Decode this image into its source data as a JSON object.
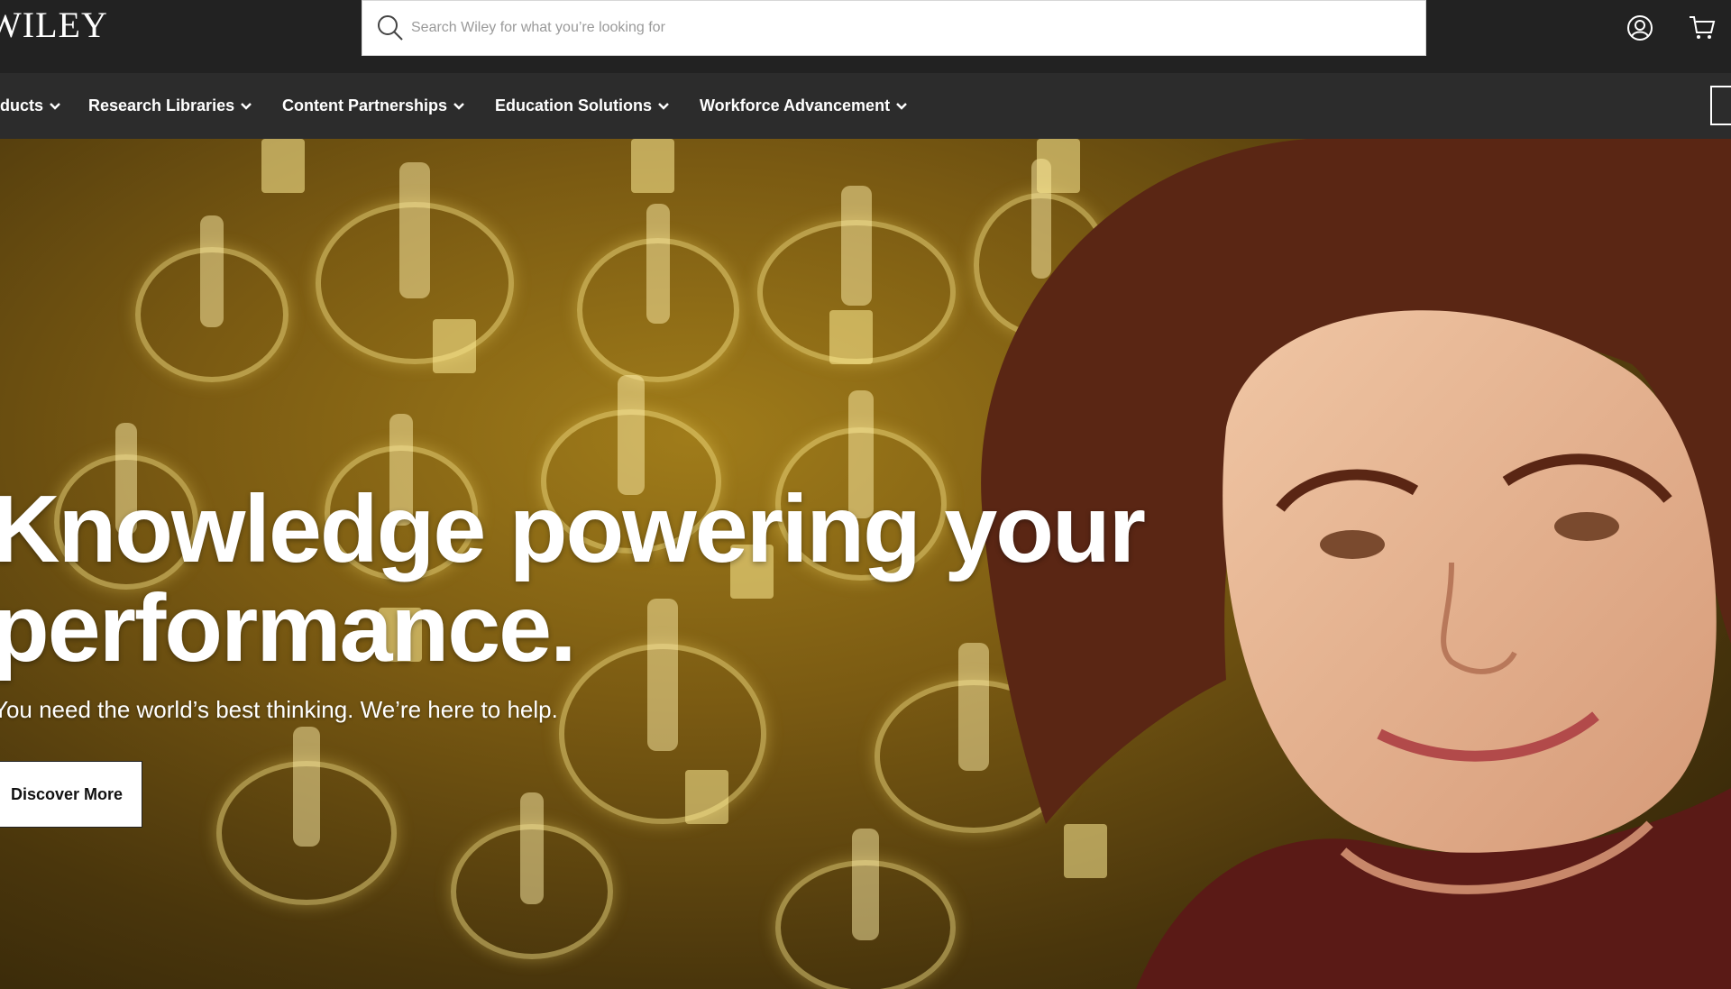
{
  "brand": {
    "logo_text": "WILEY"
  },
  "search": {
    "placeholder": "Search Wiley for what you’re looking for",
    "value": ""
  },
  "header_icons": [
    "search-icon",
    "account-icon",
    "cart-icon"
  ],
  "nav": {
    "items": [
      {
        "label": "Products"
      },
      {
        "label": "Research Libraries"
      },
      {
        "label": "Content Partnerships"
      },
      {
        "label": "Education Solutions"
      },
      {
        "label": "Workforce Advancement"
      }
    ]
  },
  "hero": {
    "headline_line1": "Knowledge powering your",
    "headline_line2": "performance.",
    "subhead": "You need the world’s best thinking. We’re here to help.",
    "cta_label": "Discover More"
  },
  "colors": {
    "topbar": "#222222",
    "navbar": "#2c2c2c",
    "hero_gold": "#a07c1a",
    "text": "#ffffff"
  }
}
